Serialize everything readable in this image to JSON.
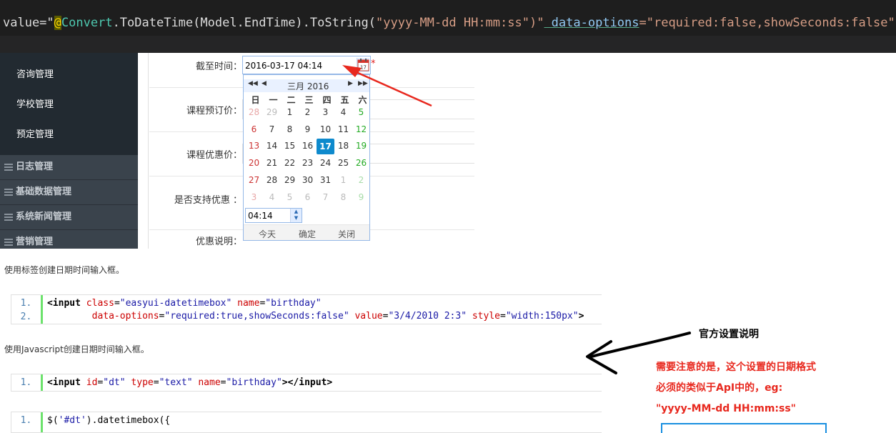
{
  "editor": {
    "seg1": "value=\"",
    "seg2": "@",
    "seg3": "Convert",
    "seg4": ".ToDateTime(Model.EndTime).ToString(",
    "seg5": "\"yyyy-MM-dd HH:mm:ss\")\"",
    "seg6": " data-options",
    "seg7": "=\"required:false,showSeconds:false\" />"
  },
  "sidebar": {
    "sub_items": [
      "咨询管理",
      "学校管理",
      "预定管理"
    ],
    "groups": [
      "日志管理",
      "基础数据管理",
      "系统新闻管理",
      "营销管理"
    ]
  },
  "form": {
    "rows": [
      {
        "label": "截至时间："
      },
      {
        "label": "课程预订价："
      },
      {
        "label": "课程优惠价："
      },
      {
        "label": "是否支持优惠 ："
      },
      {
        "label": "优惠说明："
      }
    ],
    "datetime_value": "2016-03-17 04:14",
    "required_mark": "*"
  },
  "datepicker": {
    "nav_prev_year": "◀◀",
    "nav_prev_month": "◀",
    "nav_next_month": "▶",
    "nav_next_year": "▶▶",
    "month_title": "三月 2016",
    "weekdays": [
      "日",
      "一",
      "二",
      "三",
      "四",
      "五",
      "六"
    ],
    "weeks": [
      [
        "28",
        "29",
        "1",
        "2",
        "3",
        "4",
        "5"
      ],
      [
        "6",
        "7",
        "8",
        "9",
        "10",
        "11",
        "12"
      ],
      [
        "13",
        "14",
        "15",
        "16",
        "17",
        "18",
        "19"
      ],
      [
        "20",
        "21",
        "22",
        "23",
        "24",
        "25",
        "26"
      ],
      [
        "27",
        "28",
        "29",
        "30",
        "31",
        "1",
        "2"
      ],
      [
        "3",
        "4",
        "5",
        "6",
        "7",
        "8",
        "9"
      ]
    ],
    "selected": "17",
    "time_value": "04:14",
    "spin_up": "▲",
    "spin_down": "▼",
    "btn_today": "今天",
    "btn_ok": "确定",
    "btn_close": "关闭"
  },
  "docs": {
    "text1": "使用标签创建日期时间输入框。",
    "text2": "使用Javascript创建日期时间输入框。",
    "block1_ln": [
      "1.",
      "2."
    ],
    "block2_ln": [
      "1."
    ],
    "block3_ln": [
      "1."
    ]
  },
  "annotation": {
    "title": "官方设置说明",
    "note_lines": [
      "需要注意的是，这个设置的日期格式",
      "必须的类似于ApI中的，eg:",
      "\"yyyy-MM-dd HH:mm:ss\""
    ]
  },
  "colors": {
    "annotation_red": "#e8281e",
    "selected_day": "#0e8acd",
    "sidebar_bg": "#293038"
  }
}
